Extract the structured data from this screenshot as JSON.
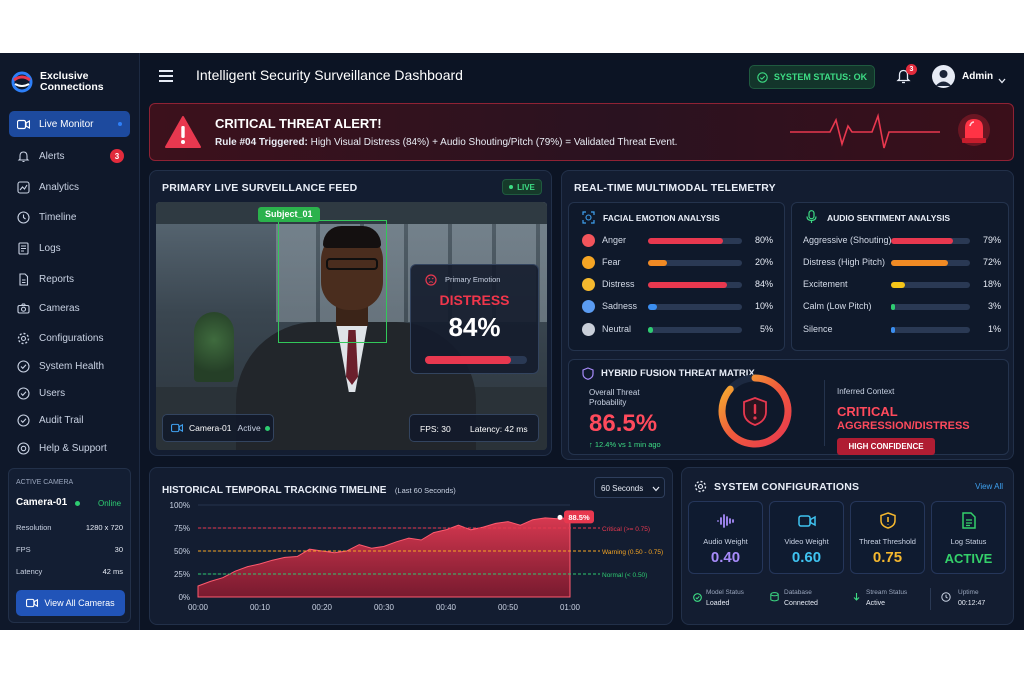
{
  "brand": {
    "line1": "Exclusive",
    "line2": "Connections"
  },
  "header": {
    "title": "Intelligent Security Surveillance Dashboard",
    "system_status": "SYSTEM STATUS: OK",
    "notification_count": "3",
    "user": "Admin"
  },
  "sidebar": {
    "items": [
      {
        "label": "Live Monitor",
        "icon": "video-icon"
      },
      {
        "label": "Alerts",
        "icon": "bell-icon",
        "badge": "3"
      },
      {
        "label": "Analytics",
        "icon": "chart-icon"
      },
      {
        "label": "Timeline",
        "icon": "clock-icon"
      },
      {
        "label": "Logs",
        "icon": "log-icon"
      },
      {
        "label": "Reports",
        "icon": "report-icon"
      },
      {
        "label": "Cameras",
        "icon": "camera-icon"
      },
      {
        "label": "Configurations",
        "icon": "gear-icon"
      },
      {
        "label": "System Health",
        "icon": "health-icon"
      },
      {
        "label": "Users",
        "icon": "users-icon"
      },
      {
        "label": "Audit Trail",
        "icon": "audit-icon"
      },
      {
        "label": "Help & Support",
        "icon": "help-icon"
      }
    ],
    "active_camera": {
      "heading": "ACTIVE CAMERA",
      "name": "Camera-01",
      "status": "Online",
      "rows": [
        {
          "k": "Resolution",
          "v": "1280 x 720"
        },
        {
          "k": "FPS",
          "v": "30"
        },
        {
          "k": "Latency",
          "v": "42 ms"
        }
      ],
      "button": "View All Cameras"
    }
  },
  "alert": {
    "title": "CRITICAL THREAT ALERT!",
    "rule": "Rule #04 Triggered:",
    "detail": "High Visual Distress (84%) + Audio Shouting/Pitch (79%) = Validated Threat Event."
  },
  "feed": {
    "title": "PRIMARY LIVE SURVEILLANCE FEED",
    "live": "LIVE",
    "subject": "Subject_01",
    "emotion_label": "Primary Emotion",
    "emotion": "DISTRESS",
    "emotion_pct": "84%",
    "emotion_level": 0.84,
    "camera": "Camera-01",
    "camera_state": "Active",
    "fps": "FPS: 30",
    "latency": "Latency: 42 ms"
  },
  "telemetry": {
    "title": "REAL-TIME MULTIMODAL TELEMETRY",
    "facial": {
      "title": "FACIAL EMOTION ANALYSIS",
      "rows": [
        {
          "label": "Anger",
          "pct": "80%",
          "value": 0.8,
          "color": "#e8384f",
          "icon": "#f2545b"
        },
        {
          "label": "Fear",
          "pct": "20%",
          "value": 0.2,
          "color": "#f08a24",
          "icon": "#f5a524"
        },
        {
          "label": "Distress",
          "pct": "84%",
          "value": 0.84,
          "color": "#e8384f",
          "icon": "#f5b82e"
        },
        {
          "label": "Sadness",
          "pct": "10%",
          "value": 0.1,
          "color": "#3b8ef0",
          "icon": "#5b9cf2"
        },
        {
          "label": "Neutral",
          "pct": "5%",
          "value": 0.05,
          "color": "#2ecc71",
          "icon": "#c9cfd9"
        }
      ]
    },
    "audio": {
      "title": "AUDIO SENTIMENT ANALYSIS",
      "rows": [
        {
          "label": "Aggressive (Shouting)",
          "pct": "79%",
          "value": 0.79,
          "color": "#e8384f"
        },
        {
          "label": "Distress (High Pitch)",
          "pct": "72%",
          "value": 0.72,
          "color": "#f08a24"
        },
        {
          "label": "Excitement",
          "pct": "18%",
          "value": 0.18,
          "color": "#f5c518"
        },
        {
          "label": "Calm (Low Pitch)",
          "pct": "3%",
          "value": 0.03,
          "color": "#2ecc71"
        },
        {
          "label": "Silence",
          "pct": "1%",
          "value": 0.01,
          "color": "#3b8ef0"
        }
      ]
    },
    "fusion": {
      "title": "HYBRID FUSION THREAT MATRIX",
      "prob_label": "Overall Threat Probability",
      "prob": "86.5%",
      "delta": "12.4% vs 1 min ago",
      "context_label": "Inferred Context",
      "context_line1": "CRITICAL",
      "context_line2": "AGGRESSION/DISTRESS",
      "confidence": "HIGH CONFIDENCE"
    }
  },
  "timeline": {
    "title": "HISTORICAL TEMPORAL TRACKING TIMELINE",
    "subtitle": "(Last 60 Seconds)",
    "range": "60 Seconds"
  },
  "chart_data": {
    "type": "area",
    "title": "HISTORICAL TEMPORAL TRACKING TIMELINE",
    "subtitle": "(Last 60 Seconds)",
    "x_ticks": [
      "00:00",
      "00:10",
      "00:20",
      "00:30",
      "00:40",
      "00:50",
      "01:00"
    ],
    "y_ticks": [
      "0%",
      "25%",
      "50%",
      "75%",
      "100%"
    ],
    "ylim": [
      0,
      100
    ],
    "x": [
      0,
      2,
      4,
      6,
      8,
      10,
      12,
      14,
      16,
      18,
      20,
      22,
      24,
      26,
      28,
      30,
      32,
      34,
      36,
      38,
      40,
      42,
      44,
      46,
      48,
      50,
      52,
      54,
      56,
      58,
      60
    ],
    "values": [
      12,
      17,
      21,
      28,
      33,
      36,
      40,
      43,
      44,
      52,
      50,
      48,
      50,
      57,
      53,
      55,
      60,
      64,
      62,
      70,
      73,
      78,
      73,
      76,
      80,
      82,
      78,
      84,
      86,
      85,
      86.5
    ],
    "last_label": "88.5%",
    "thresholds": [
      {
        "label": "Critical (>= 0.75)",
        "value": 75,
        "color": "#e8384f"
      },
      {
        "label": "Warning (0.50 - 0.75)",
        "value": 50,
        "color": "#f5a524"
      },
      {
        "label": "Normal (< 0.50)",
        "value": 25,
        "color": "#2ecc71"
      }
    ],
    "grid": true
  },
  "config": {
    "title": "SYSTEM CONFIGURATIONS",
    "view_all": "View All",
    "cards": [
      {
        "label": "Audio Weight",
        "value": "0.40",
        "color": "#a78bfa",
        "icon": "waveform-icon"
      },
      {
        "label": "Video Weight",
        "value": "0.60",
        "color": "#3fc3f0",
        "icon": "video-icon"
      },
      {
        "label": "Threat Threshold",
        "value": "0.75",
        "color": "#f5b82e",
        "icon": "shield-icon"
      },
      {
        "label": "Log Status",
        "value": "ACTIVE",
        "color": "#34d06a",
        "icon": "document-icon"
      }
    ],
    "status": [
      {
        "k": "Model Status",
        "v": "Loaded"
      },
      {
        "k": "Database",
        "v": "Connected"
      },
      {
        "k": "Stream Status",
        "v": "Active"
      },
      {
        "k": "Uptime",
        "v": "00:12:47"
      }
    ]
  }
}
